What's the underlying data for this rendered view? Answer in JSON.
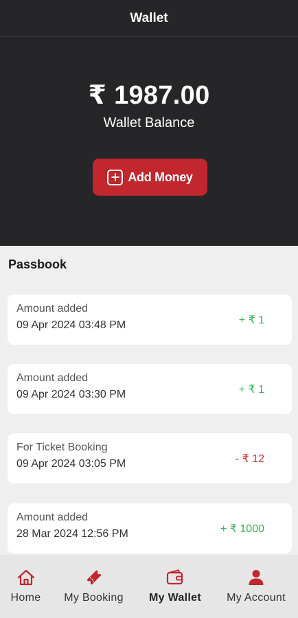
{
  "header": {
    "title": "Wallet"
  },
  "wallet": {
    "balance": "₹ 1987.00",
    "balance_label": "Wallet Balance",
    "add_money_label": "Add Money"
  },
  "passbook": {
    "title": "Passbook",
    "entries": [
      {
        "description": "Amount added",
        "date": "09 Apr 2024 03:48 PM",
        "amount": "+ ₹ 1",
        "type": "credit"
      },
      {
        "description": "Amount added",
        "date": "09 Apr 2024 03:30 PM",
        "amount": "+ ₹ 1",
        "type": "credit"
      },
      {
        "description": "For Ticket Booking",
        "date": "09 Apr 2024 03:05 PM",
        "amount": "- ₹ 12",
        "type": "debit"
      },
      {
        "description": "Amount added",
        "date": "28 Mar 2024 12:56 PM",
        "amount": "+ ₹ 1000",
        "type": "credit"
      }
    ]
  },
  "nav": {
    "items": [
      {
        "label": "Home",
        "icon": "home-icon",
        "active": false
      },
      {
        "label": "My Booking",
        "icon": "ticket-icon",
        "active": false
      },
      {
        "label": "My Wallet",
        "icon": "wallet-icon",
        "active": true
      },
      {
        "label": "My Account",
        "icon": "person-icon",
        "active": false
      }
    ]
  },
  "colors": {
    "accent": "#c1272d",
    "dark_bg": "#262629",
    "credit": "#2eb84b",
    "debit": "#d82a2a"
  }
}
